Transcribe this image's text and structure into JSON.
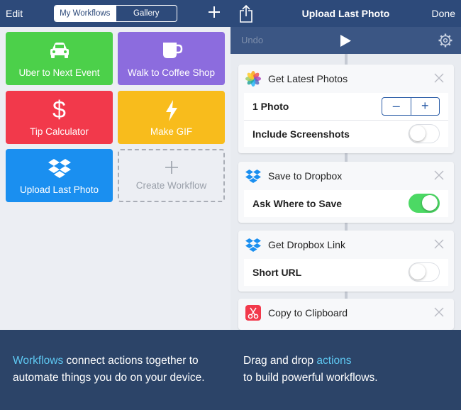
{
  "colors": {
    "nav": "#2d4a7a",
    "toolbar": "#3b5684",
    "accent": "#5ec8f2",
    "toggle_on": "#4cd964",
    "caption_bg": "#2c4468"
  },
  "left": {
    "nav": {
      "edit_label": "Edit",
      "segments": [
        "My Workflows",
        "Gallery"
      ],
      "add_icon": "plus-icon"
    },
    "workflows": [
      {
        "label": "Uber to Next Event",
        "icon": "car-icon",
        "color": "#4cd04a"
      },
      {
        "label": "Walk to Coffee Shop",
        "icon": "coffee-cup-icon",
        "color": "#8c6cde"
      },
      {
        "label": "Tip Calculator",
        "icon": "dollar-icon",
        "color": "#f2394b"
      },
      {
        "label": "Make GIF",
        "icon": "lightning-icon",
        "color": "#f8bc1c"
      },
      {
        "label": "Upload Last Photo",
        "icon": "dropbox-icon",
        "color": "#1a8ff0"
      }
    ],
    "create": {
      "label": "Create Workflow",
      "icon": "plus-icon"
    }
  },
  "right": {
    "nav": {
      "title": "Upload Last Photo",
      "done_label": "Done",
      "share_icon": "share-icon"
    },
    "toolbar": {
      "undo_label": "Undo",
      "play_icon": "play-icon",
      "settings_icon": "gear-icon"
    },
    "actions": [
      {
        "title": "Get Latest Photos",
        "icon": "photos-icon",
        "rows": [
          {
            "label": "1 Photo",
            "control": "stepper"
          },
          {
            "label": "Include Screenshots",
            "control": "toggle",
            "on": false
          }
        ]
      },
      {
        "title": "Save to Dropbox",
        "icon": "dropbox-icon",
        "rows": [
          {
            "label": "Ask Where to Save",
            "control": "toggle",
            "on": true
          }
        ]
      },
      {
        "title": "Get Dropbox Link",
        "icon": "dropbox-icon",
        "rows": [
          {
            "label": "Short URL",
            "control": "toggle",
            "on": false
          }
        ]
      },
      {
        "title": "Copy to Clipboard",
        "icon": "scissors-icon",
        "rows": []
      }
    ]
  },
  "captions": {
    "left": {
      "accent": "Workflows",
      "line1_rest": " connect actions together to",
      "line2": "automate things you do on your device."
    },
    "right": {
      "line1_start": "Drag and drop ",
      "accent": "actions",
      "line2": "to build powerful workflows."
    }
  }
}
